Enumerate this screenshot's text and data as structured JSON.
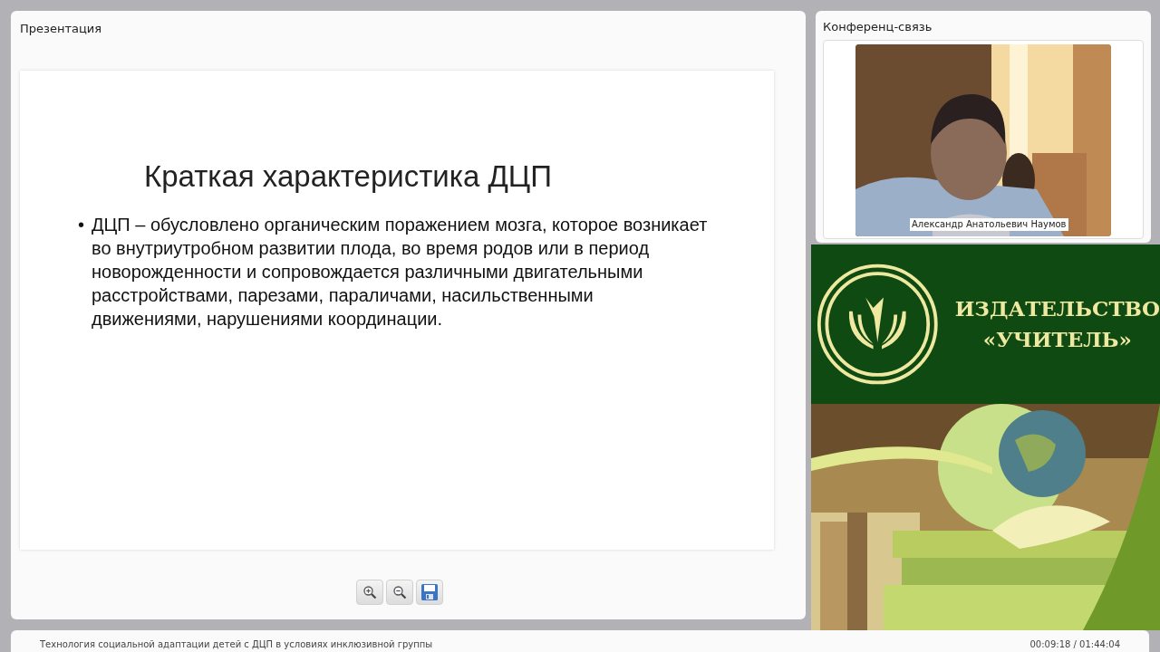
{
  "presentation": {
    "title": "Презентация",
    "slide": {
      "heading": "Краткая характеристика ДЦП",
      "bullets": [
        {
          "marker": "•",
          "text": "ДЦП – обусловлено  органическим поражением мозга, которое возникает во внутриутробном развитии плода, во время родов или в период новорожденности и сопровождается различными двигательными расстройствами, парезами, параличами, насильственными движениями, нарушениями координации."
        }
      ]
    },
    "toolbar": [
      {
        "kind": "zoom_in"
      },
      {
        "kind": "zoom_out"
      },
      {
        "kind": "save"
      }
    ]
  },
  "conference": {
    "title": "Конференц-связь",
    "video": {
      "kind": "picture",
      "participant": "Александр Анатольевич Наумов"
    }
  },
  "banner": {
    "line_1": "ИЗДАТЕЛЬСТВО",
    "line_2": "«УЧИТЕЛЬ»"
  },
  "footer": {
    "course_title": "Технология социальной адаптации детей с ДЦП в условиях инклюзивной группы",
    "time": "00:09:18 / 01:44:04"
  }
}
